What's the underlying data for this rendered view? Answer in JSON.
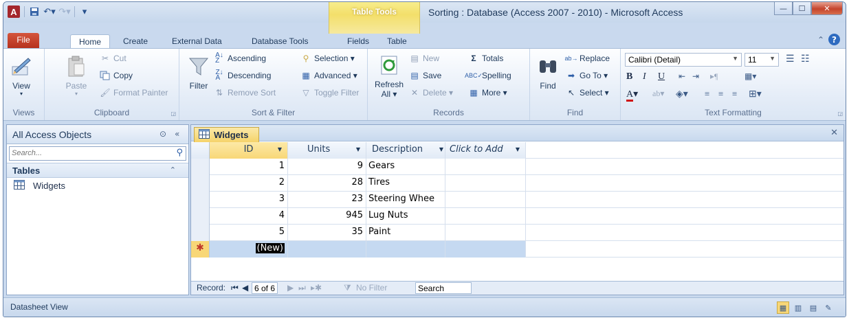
{
  "window": {
    "title": "Sorting : Database (Access 2007 - 2010)  -  Microsoft Access",
    "contextual_tab_group": "Table Tools",
    "app_icon_letter": "A",
    "controls": {
      "minimize": "—",
      "maximize": "☐",
      "close": "✕"
    }
  },
  "ribbon_tabs": [
    "File",
    "Home",
    "Create",
    "External Data",
    "Database Tools",
    "Fields",
    "Table"
  ],
  "ribbon": {
    "views": {
      "label": "Views",
      "view_btn": "View"
    },
    "clipboard": {
      "label": "Clipboard",
      "paste": "Paste",
      "cut": "Cut",
      "copy": "Copy",
      "format_painter": "Format Painter"
    },
    "sort_filter": {
      "label": "Sort & Filter",
      "filter": "Filter",
      "ascending": "Ascending",
      "descending": "Descending",
      "remove_sort": "Remove Sort",
      "selection": "Selection ▾",
      "advanced": "Advanced ▾",
      "toggle_filter": "Toggle Filter"
    },
    "records": {
      "label": "Records",
      "refresh": "Refresh",
      "refresh_sub": "All ▾",
      "new": "New",
      "save": "Save",
      "delete": "Delete ▾",
      "totals": "Totals",
      "spelling": "Spelling",
      "more": "More ▾"
    },
    "find": {
      "label": "Find",
      "find": "Find",
      "replace": "Replace",
      "goto": "Go To ▾",
      "select": "Select ▾"
    },
    "text_formatting": {
      "label": "Text Formatting",
      "font": "Calibri (Detail)",
      "size": "11"
    }
  },
  "nav_pane": {
    "title": "All Access Objects",
    "search_placeholder": "Search...",
    "group": "Tables",
    "items": [
      {
        "label": "Widgets"
      }
    ]
  },
  "document": {
    "tab_label": "Widgets",
    "columns": [
      "ID",
      "Units",
      "Description",
      "Click to Add"
    ],
    "rows": [
      {
        "id": "1",
        "units": "9",
        "description": "Gears"
      },
      {
        "id": "2",
        "units": "28",
        "description": "Tires"
      },
      {
        "id": "3",
        "units": "23",
        "description": "Steering Whee"
      },
      {
        "id": "4",
        "units": "945",
        "description": "Lug Nuts"
      },
      {
        "id": "5",
        "units": "35",
        "description": "Paint"
      }
    ],
    "new_row_marker": "✱",
    "new_row_label": "(New)"
  },
  "record_nav": {
    "label": "Record:",
    "position": "6 of 6",
    "no_filter": "No Filter",
    "search": "Search"
  },
  "status": {
    "text": "Datasheet View"
  }
}
